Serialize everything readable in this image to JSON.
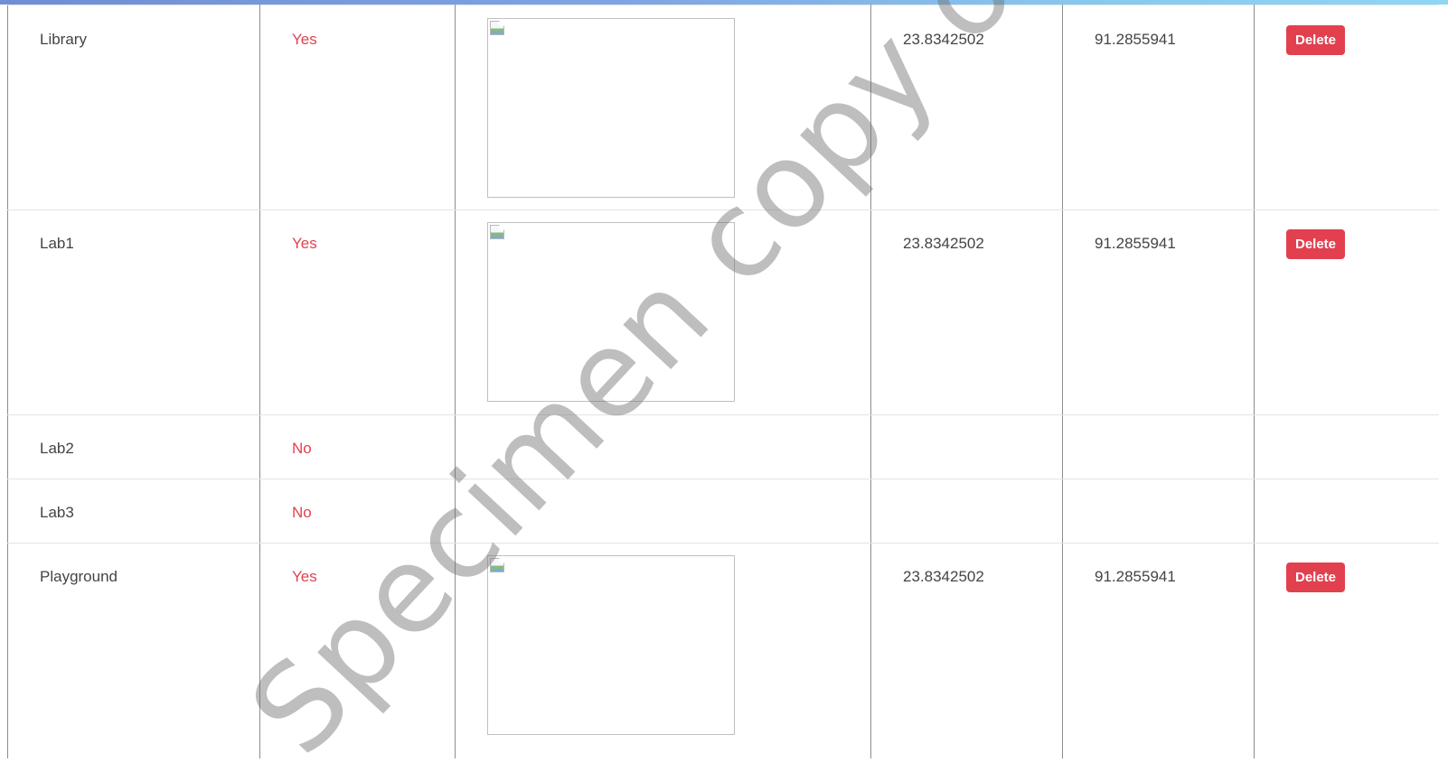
{
  "table": {
    "rows": [
      {
        "name": "Library",
        "status": "Yes",
        "has_image": true,
        "latitude": "23.8342502",
        "longitude": "91.2855941",
        "action": "Delete"
      },
      {
        "name": "Lab1",
        "status": "Yes",
        "has_image": true,
        "latitude": "23.8342502",
        "longitude": "91.2855941",
        "action": "Delete"
      },
      {
        "name": "Lab2",
        "status": "No",
        "has_image": false,
        "latitude": "",
        "longitude": "",
        "action": ""
      },
      {
        "name": "Lab3",
        "status": "No",
        "has_image": false,
        "latitude": "",
        "longitude": "",
        "action": ""
      },
      {
        "name": "Playground",
        "status": "Yes",
        "has_image": true,
        "latitude": "23.8342502",
        "longitude": "91.2855941",
        "action": "Delete"
      }
    ]
  },
  "watermark": {
    "text": "Specimen copy of ITEP"
  },
  "colors": {
    "status_text": "#e0424f",
    "delete_button": "#e2404f",
    "topbar_start": "#6f8ed6",
    "topbar_end": "#8fd6f5"
  },
  "icons": {
    "broken_image": "broken-image-icon"
  }
}
